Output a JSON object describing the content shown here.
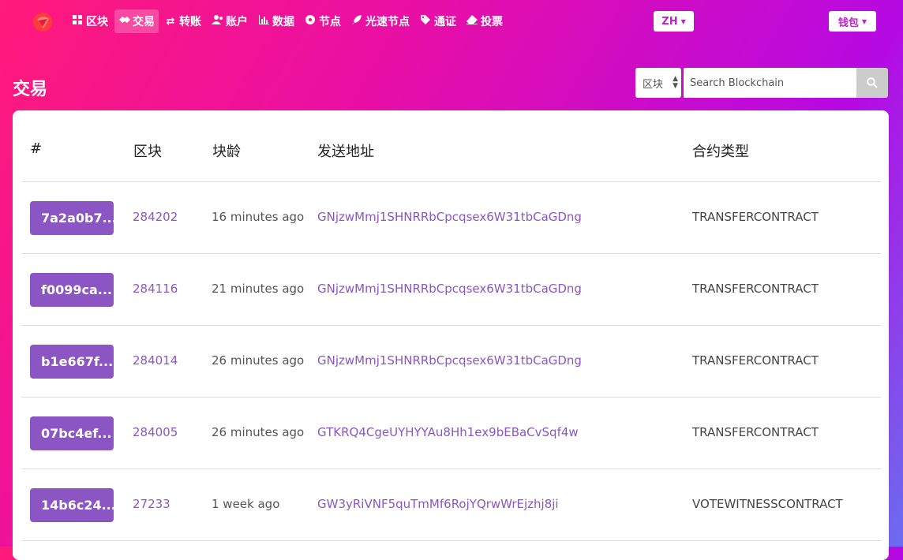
{
  "nav": {
    "items": [
      {
        "label": "区块",
        "icon": "grid-icon"
      },
      {
        "label": "交易",
        "icon": "handshake-icon",
        "active": true
      },
      {
        "label": "转账",
        "icon": "exchange-icon"
      },
      {
        "label": "账户",
        "icon": "users-icon"
      },
      {
        "label": "数据",
        "icon": "bar-chart-icon"
      },
      {
        "label": "节点",
        "icon": "circle-dot-icon"
      },
      {
        "label": "光速节点",
        "icon": "rocket-icon"
      },
      {
        "label": "通证",
        "icon": "tag-icon"
      },
      {
        "label": "投票",
        "icon": "eraser-icon"
      }
    ],
    "language": "ZH",
    "wallet": "钱包"
  },
  "page": {
    "title": "交易"
  },
  "search": {
    "scope": "区块",
    "placeholder": "Search Blockchain"
  },
  "table": {
    "headers": {
      "hash": "#",
      "block": "区块",
      "age": "块龄",
      "from": "发送地址",
      "type": "合约类型"
    },
    "rows": [
      {
        "hash": "7a2a0b7...",
        "block": "284202",
        "age": "16 minutes ago",
        "from": "GNjzwMmj1SHNRRbCpcqsex6W31tbCaGDng",
        "type": "TRANSFERCONTRACT"
      },
      {
        "hash": "f0099ca...",
        "block": "284116",
        "age": "21 minutes ago",
        "from": "GNjzwMmj1SHNRRbCpcqsex6W31tbCaGDng",
        "type": "TRANSFERCONTRACT"
      },
      {
        "hash": "b1e667f...",
        "block": "284014",
        "age": "26 minutes ago",
        "from": "GNjzwMmj1SHNRRbCpcqsex6W31tbCaGDng",
        "type": "TRANSFERCONTRACT"
      },
      {
        "hash": "07bc4ef...",
        "block": "284005",
        "age": "26 minutes ago",
        "from": "GTKRQ4CgeUYHYYAu8Hh1ex9bEBaCvSqf4w",
        "type": "TRANSFERCONTRACT"
      },
      {
        "hash": "14b6c24...",
        "block": "27233",
        "age": "1 week ago",
        "from": "GW3yRiVNF5quTmMf6RojYQrwWrEjzhj8ji",
        "type": "VOTEWITNESSCONTRACT"
      }
    ]
  },
  "colors": {
    "accent": "#8b56c4",
    "brand": "#c21fd0"
  }
}
